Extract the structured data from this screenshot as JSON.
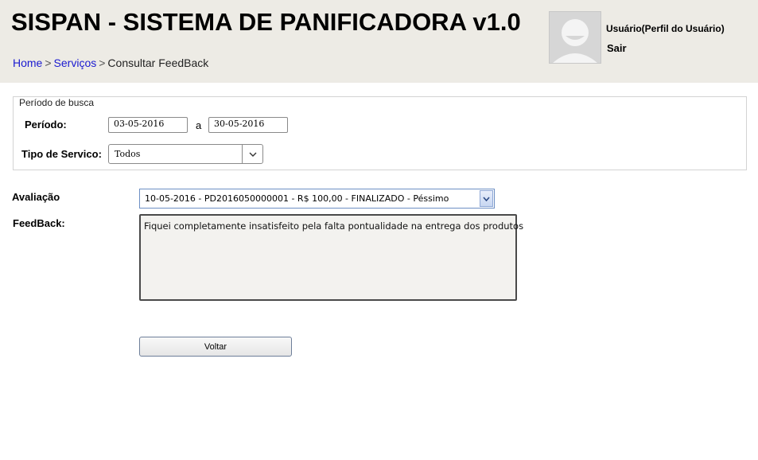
{
  "header": {
    "title": "SISPAN - SISTEMA DE PANIFICADORA v1.0",
    "breadcrumb": {
      "home": "Home",
      "sep1": ">",
      "servicos": "Serviços",
      "sep2": ">",
      "current": "Consultar FeedBack"
    },
    "user": {
      "name": "Usuário(Perfil do Usuário)",
      "logout": "Sair",
      "avatar_icon": "user-avatar-icon"
    }
  },
  "search": {
    "legend": "Período de busca",
    "period_label": "Período:",
    "date_from": "03-05-2016",
    "date_sep": "a",
    "date_to": "30-05-2016",
    "service_type_label": "Tipo de Servico:",
    "service_type_value": "Todos",
    "dropdown_icon": "chevron-down-icon"
  },
  "detail": {
    "avaliacao_label": "Avaliação",
    "avaliacao_value": "10-05-2016 - PD2016050000001 - R$ 100,00 - FINALIZADO - Péssimo",
    "feedback_label": "FeedBack:",
    "feedback_text": "Fiquei completamente insatisfeito pela falta pontualidade na entrega dos produtos"
  },
  "actions": {
    "back_label": "Voltar"
  },
  "colors": {
    "header_bg": "#edebe5",
    "link": "#1a1ad0",
    "select_border_blue": "#6d8fc4"
  }
}
